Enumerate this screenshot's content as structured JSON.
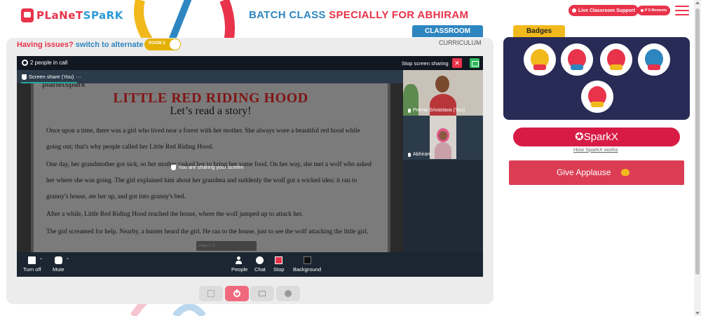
{
  "app": {
    "logo_part1": "PLaNeT",
    "logo_part2": "SPaRK",
    "title_part1": "BATCH CLASS ",
    "title_part2": "SPECIALLY FOR ABHIRAM"
  },
  "header": {
    "live_support_label": "Live Classroom Support",
    "moments_label": "P S Moments"
  },
  "issue_bar": {
    "question": "Having issues?",
    "link": "switch to alternate room",
    "toggle_label": "ROOM 2"
  },
  "tabs": {
    "classroom": "CLASSROOM",
    "curriculum": "CURRICULUM"
  },
  "call": {
    "people_count": "2 people in call",
    "stop_sharing": "Stop screen sharing",
    "close_symbol": "✕",
    "screen_share_label": "Screen share (You)",
    "more_symbol": "···",
    "sharing_notice": "You are sharing your screen",
    "participants": [
      {
        "name": "Prerna Srivastava (You)"
      },
      {
        "name": "Abhiram"
      }
    ],
    "controls": {
      "camera": "Turn off",
      "mic": "Mute",
      "people": "People",
      "chat": "Chat",
      "stop": "Stop",
      "background": "Background"
    }
  },
  "document": {
    "logo": "planetspark",
    "title": "LITTLE RED RIDING HOOD",
    "subtitle": "Let’s read a story!",
    "paragraphs": [
      "Once upon a time, there was a girl who lived near a forest with her mother. She always wore a beautiful red hood while going out; that's why people called her Little Red Riding Hood.",
      "One day, her grandmother got sick, so her mother tasked her to bring her some food. On her way, she met a wolf who asked her where she was going. The girl explained him about her grandma and suddenly the wolf got a wicked idea: it ran to granny's house, ate her up, and got into granny's bed.",
      "After a while, Little Red Riding Hood reached the house, where the wolf jumped up to attack her.",
      "The girl screamed for help. Nearby, a hunter heard the girl. He ran to the house, just to see the wolf attacking the little girl."
    ],
    "pager_label": "Page  1  /  1"
  },
  "right_panel": {
    "badges_tab": "Badges",
    "badges": [
      {
        "icon": "trophy-badge-icon",
        "color": "#f2b91c"
      },
      {
        "icon": "hero-badge-icon",
        "color": "#e8334a"
      },
      {
        "icon": "rocket-badge-icon",
        "color": "#e8334a"
      },
      {
        "icon": "lock-badge-icon",
        "color": "#2e86c1"
      },
      {
        "icon": "mask-badge-icon",
        "color": "#e8334a"
      }
    ],
    "sparkx_label": "SparkX",
    "sparkx_help": "How SparkX works",
    "applause_label": "Give Applause"
  },
  "colors": {
    "brand_red": "#e8334a",
    "brand_blue": "#2e86c1",
    "brand_yellow": "#f2b91c",
    "badge_panel": "#272b55"
  }
}
